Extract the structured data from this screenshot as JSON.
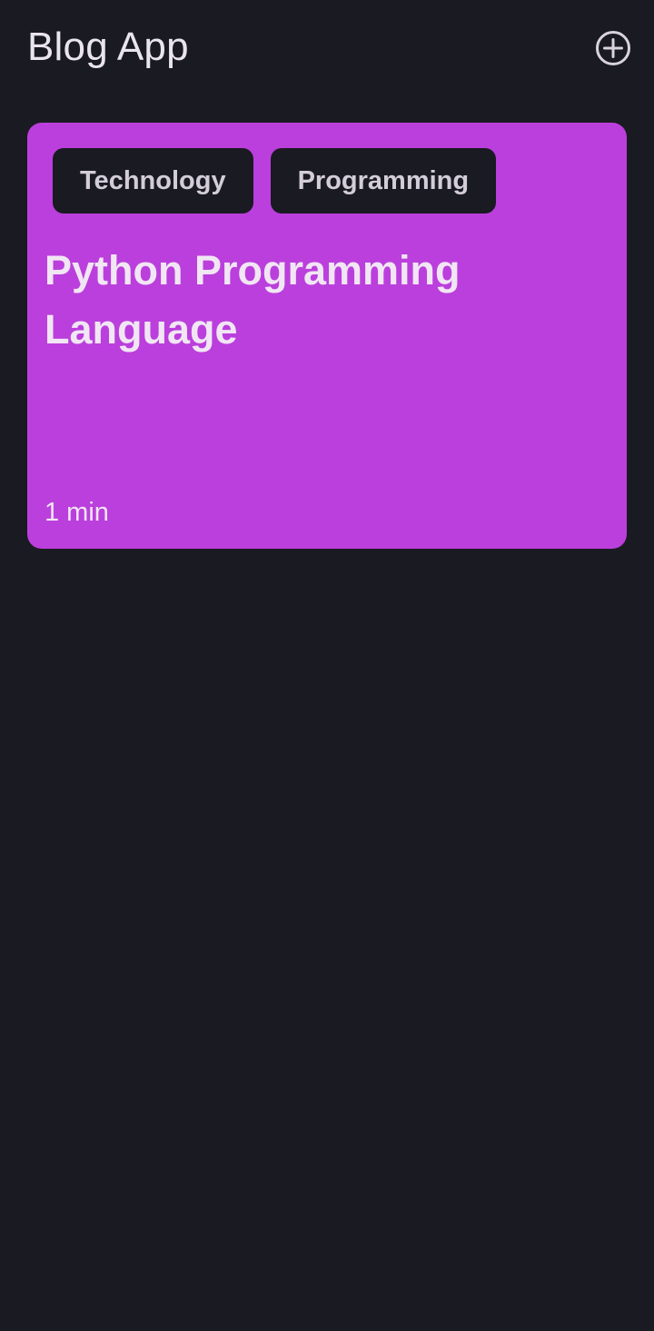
{
  "app_bar": {
    "title": "Blog App",
    "add_icon": "add-circle-icon"
  },
  "colors": {
    "background": "#1a1a22",
    "card": "#bb3fdc",
    "chip": "#1a1a22"
  },
  "blogs": [
    {
      "topics": [
        "Technology",
        "Programming"
      ],
      "title": "Python Programming Language",
      "reading_time": "1 min"
    }
  ]
}
